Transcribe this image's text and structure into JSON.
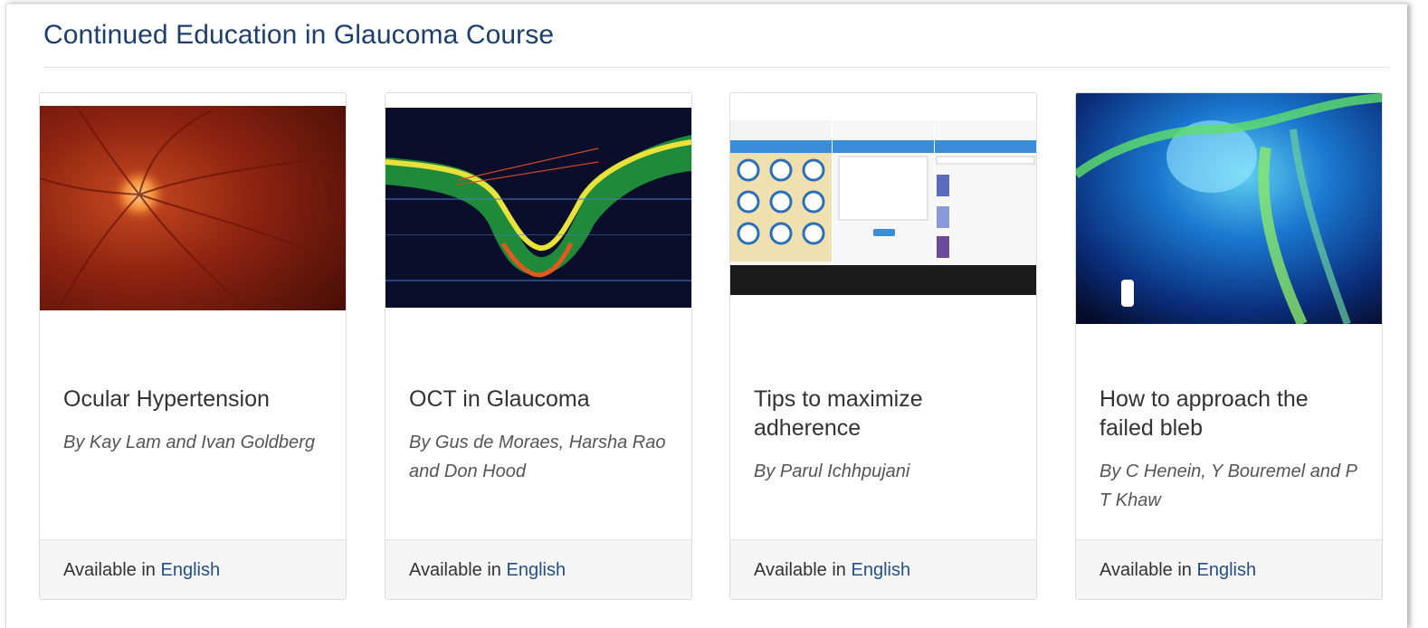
{
  "section": {
    "title": "Continued Education in Glaucoma Course"
  },
  "cards": [
    {
      "title": "Ocular Hypertension",
      "author": "By Kay Lam and Ivan Goldberg",
      "footer_prefix": "Available in",
      "language": "English"
    },
    {
      "title": "OCT in Glaucoma",
      "author": "By Gus de Moraes, Harsha Rao and Don Hood",
      "footer_prefix": "Available in",
      "language": "English"
    },
    {
      "title": "Tips to maximize adherence",
      "author": "By Parul Ichhpujani",
      "footer_prefix": "Available in",
      "language": "English"
    },
    {
      "title": "How to approach the failed bleb",
      "author": "By C Henein, Y Bouremel and P T Khaw",
      "footer_prefix": "Available in",
      "language": "English"
    }
  ],
  "colors": {
    "title": "#1c3f6e",
    "link": "#24508a",
    "footer_bg": "#f5f5f5"
  }
}
